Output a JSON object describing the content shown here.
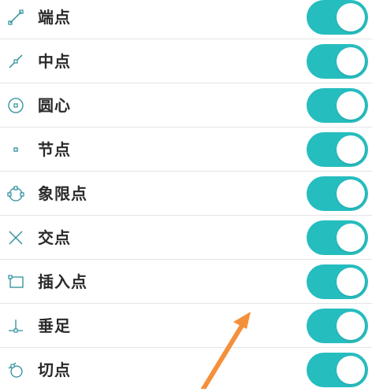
{
  "colors": {
    "accent": "#26bdbf",
    "toggle_knob": "#ffffff",
    "arrow": "#f5903a",
    "icon": "#2a8f99"
  },
  "snap_settings": [
    {
      "label": "端点",
      "icon": "endpoint-icon",
      "enabled": true
    },
    {
      "label": "中点",
      "icon": "midpoint-icon",
      "enabled": true
    },
    {
      "label": "圆心",
      "icon": "center-icon",
      "enabled": true
    },
    {
      "label": "节点",
      "icon": "node-icon",
      "enabled": true
    },
    {
      "label": "象限点",
      "icon": "quadrant-icon",
      "enabled": true
    },
    {
      "label": "交点",
      "icon": "intersection-icon",
      "enabled": true
    },
    {
      "label": "插入点",
      "icon": "insertion-icon",
      "enabled": true
    },
    {
      "label": "垂足",
      "icon": "perpendicular-icon",
      "enabled": true
    },
    {
      "label": "切点",
      "icon": "tangent-icon",
      "enabled": true
    }
  ]
}
